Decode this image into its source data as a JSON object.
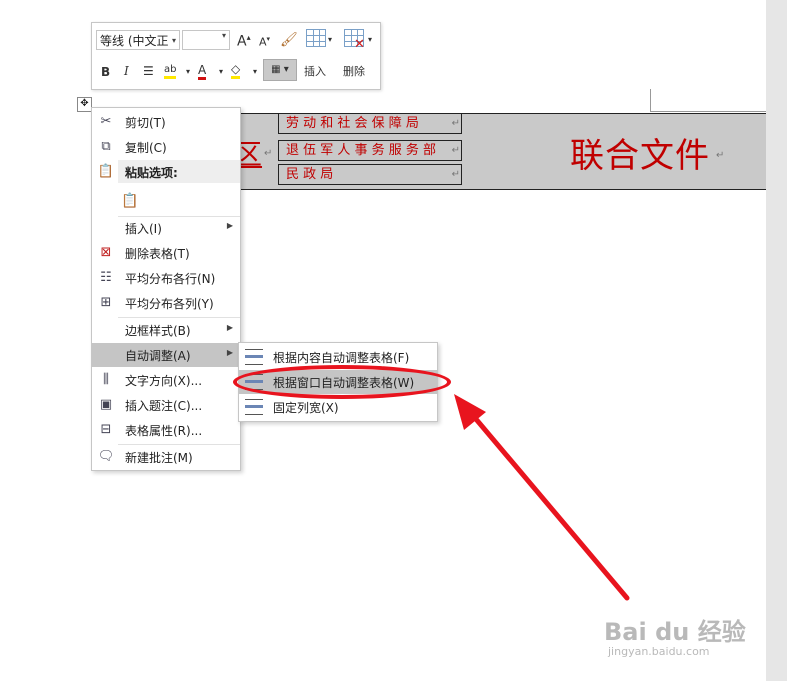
{
  "mini_toolbar": {
    "font_name": "等线 (中文正",
    "bold": "B",
    "italic": "I",
    "grow_font": "A",
    "shrink_font": "A",
    "font_color_letter": "A",
    "insert_label": "插入",
    "delete_label": "删除"
  },
  "document": {
    "rows": [
      "劳 动 和 社 会 保 障 局",
      "退 伍 军 人 事 务 服 务 部",
      "民          政          局"
    ],
    "left_fragment": "区",
    "right_title": "联合文件",
    "mark": "↵",
    "accent_color": "#c00000"
  },
  "context_menu": {
    "cut": "剪切(T)",
    "copy": "复制(C)",
    "paste_options": "粘贴选项:",
    "insert": "插入(I)",
    "delete_table": "删除表格(T)",
    "distribute_rows": "平均分布各行(N)",
    "distribute_cols": "平均分布各列(Y)",
    "border_styles": "边框样式(B)",
    "autofit": "自动调整(A)",
    "text_direction": "文字方向(X)...",
    "insert_caption": "插入题注(C)...",
    "table_properties": "表格属性(R)...",
    "new_comment": "新建批注(M)"
  },
  "autofit_submenu": {
    "autofit_contents": "根据内容自动调整表格(F)",
    "autofit_window": "根据窗口自动调整表格(W)",
    "fixed_width": "固定列宽(X)"
  },
  "watermark": {
    "brand": "Bai du 经验",
    "url": "jingyan.baidu.com"
  },
  "annotation_color": "#e8141e"
}
